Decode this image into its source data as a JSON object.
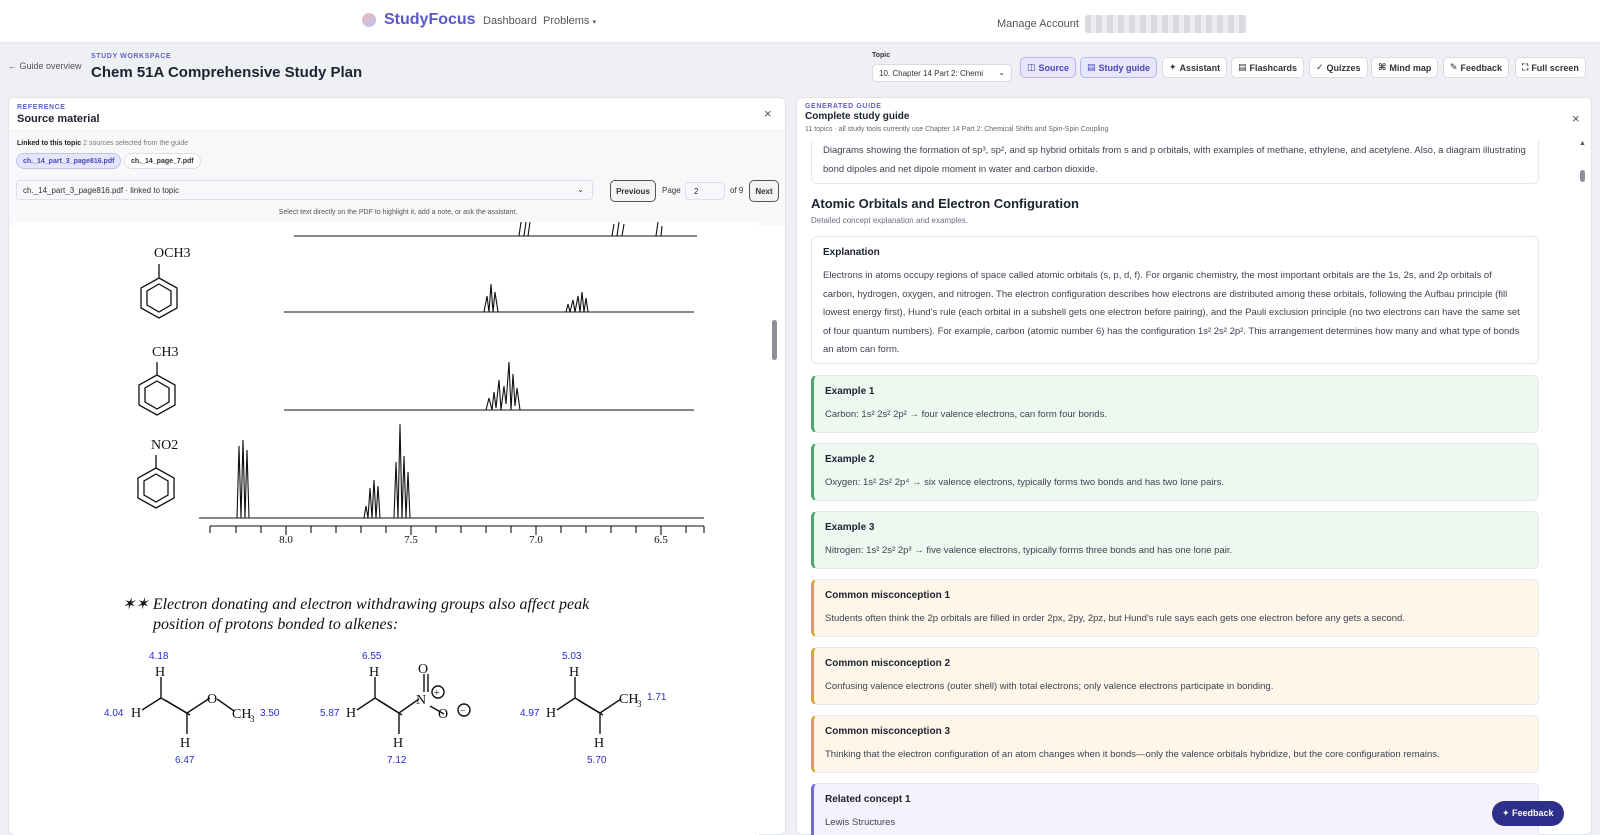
{
  "nav": {
    "brand": "StudyFocus",
    "links": [
      "Dashboard",
      "Problems"
    ],
    "manage_account": "Manage Account"
  },
  "header": {
    "back_link": "← Guide overview",
    "eyebrow": "STUDY WORKSPACE",
    "title": "Chem 51A Comprehensive Study Plan",
    "topic_label": "Topic",
    "topic_value": "10. Chapter 14 Part 2: Chemi"
  },
  "toolbar": [
    {
      "icon": "◫",
      "label": "Source",
      "active": true
    },
    {
      "icon": "▤",
      "label": "Study guide",
      "active": true
    },
    {
      "icon": "✦",
      "label": "Assistant",
      "active": false
    },
    {
      "icon": "▤",
      "label": "Flashcards",
      "active": false
    },
    {
      "icon": "✓",
      "label": "Quizzes",
      "active": false
    },
    {
      "icon": "⌘",
      "label": "Mind map",
      "active": false
    },
    {
      "icon": "✎",
      "label": "Feedback",
      "active": false
    },
    {
      "icon": "⛶",
      "label": "Full screen",
      "active": false
    }
  ],
  "source": {
    "eyebrow": "REFERENCE",
    "title": "Source material",
    "linked_label": "Linked to this topic",
    "linked_count": "2 sources selected from the guide",
    "chips": [
      "ch._14_part_3_page816.pdf",
      "ch._14_page_7.pdf"
    ],
    "file_select": "ch._14_part_3_page816.pdf · linked to topic",
    "prev": "Previous",
    "page_label": "Page",
    "page_value": "2",
    "page_of": "of 9",
    "next": "Next",
    "hint": "Select text directly on the PDF to highlight it, add a note, or ask the assistant."
  },
  "pdf": {
    "substituents": [
      "OCH3",
      "CH3",
      "NO2"
    ],
    "axis_ticks": [
      "8.0",
      "7.5",
      "7.0",
      "6.5"
    ],
    "note_line1": "✶✶ Electron donating and electron withdrawing groups also affect peak",
    "note_line2": "position of protons bonded to alkenes:",
    "mol1": {
      "top": "4.18",
      "left": "4.04",
      "bottom": "6.47",
      "right": "3.50"
    },
    "mol2": {
      "top": "6.55",
      "left": "5.87",
      "bottom": "7.12"
    },
    "mol3": {
      "top": "5.03",
      "left": "4.97",
      "bottom": "5.70",
      "right": "1.71"
    }
  },
  "guide": {
    "eyebrow": "GENERATED GUIDE",
    "title": "Complete study guide",
    "subtitle": "11 topics · all study tools currently use Chapter 14 Part 2: Chemical Shifts and Spin-Spin Coupling",
    "top_card": "Diagrams showing the formation of sp³, sp², and sp hybrid orbitals from s and p orbitals, with examples of methane, ethylene, and acetylene. Also, a diagram illustrating bond dipoles and net dipole moment in water and carbon dioxide.",
    "section_title": "Atomic Orbitals and Electron Configuration",
    "section_sub": "Detailed concept explanation and examples.",
    "explanation_title": "Explanation",
    "explanation": "Electrons in atoms occupy regions of space called atomic orbitals (s, p, d, f). For organic chemistry, the most important orbitals are the 1s, 2s, and 2p orbitals of carbon, hydrogen, oxygen, and nitrogen. The electron configuration describes how electrons are distributed among these orbitals, following the Aufbau principle (fill lowest energy first), Hund's rule (each orbital in a subshell gets one electron before pairing), and the Pauli exclusion principle (no two electrons can have the same set of four quantum numbers). For example, carbon (atomic number 6) has the configuration 1s² 2s² 2p². This arrangement determines how many and what type of bonds an atom can form.",
    "examples": [
      {
        "title": "Example 1",
        "text": "Carbon: 1s² 2s² 2p² → four valence electrons, can form four bonds."
      },
      {
        "title": "Example 2",
        "text": "Oxygen: 1s² 2s² 2p⁴ → six valence electrons, typically forms two bonds and has two lone pairs."
      },
      {
        "title": "Example 3",
        "text": "Nitrogen: 1s² 2s² 2p³ → five valence electrons, typically forms three bonds and has one lone pair."
      }
    ],
    "misconceptions": [
      {
        "title": "Common misconception 1",
        "text": "Students often think the 2p orbitals are filled in order 2px, 2py, 2pz, but Hund's rule says each gets one electron before any gets a second."
      },
      {
        "title": "Common misconception 2",
        "text": "Confusing valence electrons (outer shell) with total electrons; only valence electrons participate in bonding."
      },
      {
        "title": "Common misconception 3",
        "text": "Thinking that the electron configuration of an atom changes when it bonds—only the valence orbitals hybridize, but the core configuration remains."
      }
    ],
    "related": {
      "title": "Related concept 1",
      "text": "Lewis Structures"
    }
  },
  "feedback_fab": "✦ Feedback"
}
